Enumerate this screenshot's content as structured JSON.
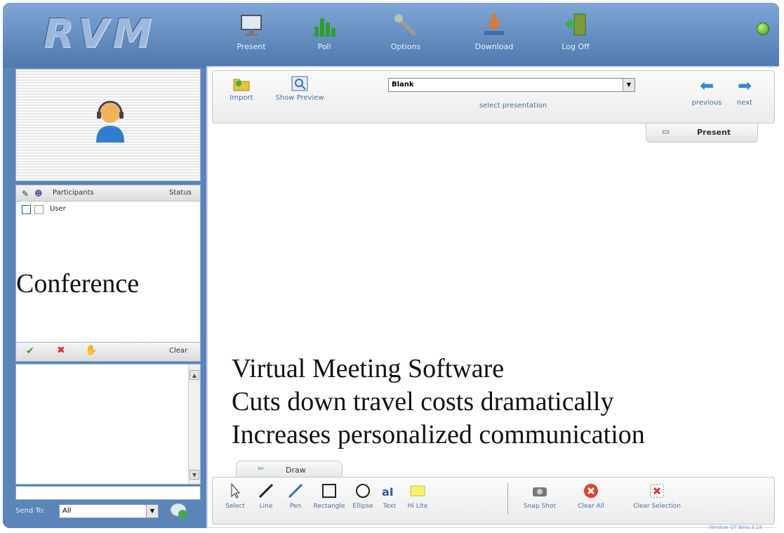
{
  "app": {
    "logo": "RVM"
  },
  "nav": [
    {
      "label": "Present",
      "icon": "monitor-icon"
    },
    {
      "label": "Poll",
      "icon": "bar-chart-icon"
    },
    {
      "label": "Options",
      "icon": "wrench-icon"
    },
    {
      "label": "Download",
      "icon": "download-icon"
    },
    {
      "label": "Log Off",
      "icon": "exit-door-icon"
    }
  ],
  "status": {
    "icon": "online-status-icon",
    "color": "#3f9a15"
  },
  "participants": {
    "header_label": "Participants",
    "status_label": "Status",
    "rows": [
      {
        "name": "User"
      }
    ],
    "clear_label": "Clear"
  },
  "chat": {
    "send_to_label": "Send To:",
    "send_to_value": "All"
  },
  "presentation": {
    "import_label": "Import",
    "show_preview_label": "Show Preview",
    "select_value": "Blank",
    "select_label": "select presentation",
    "previous_label": "previous",
    "next_label": "next",
    "present_tab_label": "Present"
  },
  "overlay": {
    "conference": "Conference",
    "lines": [
      "Virtual Meeting Software",
      "Cuts down travel costs dramatically",
      "Increases personalized communication"
    ]
  },
  "draw": {
    "tab_label": "Draw",
    "tools": [
      {
        "label": "Select",
        "icon": "cursor-icon"
      },
      {
        "label": "Line",
        "icon": "line-icon"
      },
      {
        "label": "Pen",
        "icon": "pen-icon"
      },
      {
        "label": "Rectangle",
        "icon": "rectangle-icon"
      },
      {
        "label": "Ellipse",
        "icon": "ellipse-icon"
      },
      {
        "label": "Text",
        "icon": "text-icon"
      },
      {
        "label": "Hi Lite",
        "icon": "highlight-icon"
      },
      {
        "label": "Snap Shot",
        "icon": "camera-icon"
      },
      {
        "label": "Clear All",
        "icon": "clear-all-icon"
      },
      {
        "label": "Clear Selection",
        "icon": "clear-selection-icon"
      }
    ]
  },
  "footer": {
    "version": "Window QT Beta 3.19"
  }
}
